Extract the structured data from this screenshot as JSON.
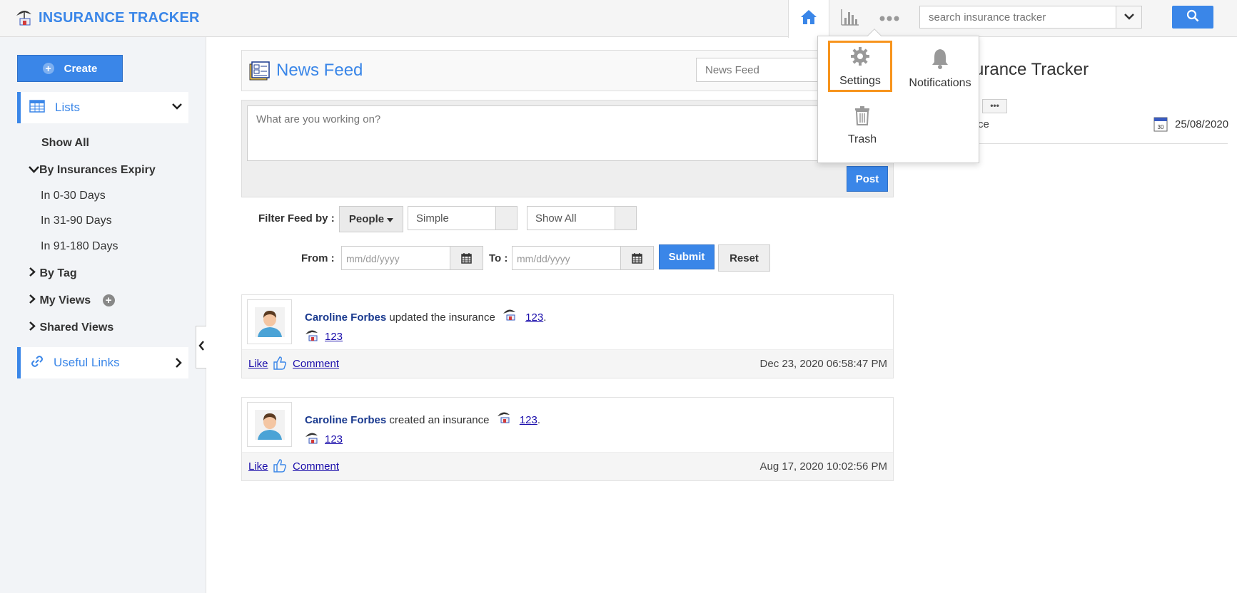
{
  "app": {
    "title": "INSURANCE TRACKER",
    "brand_color": "#3a86e8"
  },
  "header": {
    "search_placeholder": "search insurance tracker",
    "icons": [
      "home-icon",
      "chart-icon",
      "more-icon",
      "chevron-down-icon",
      "search-icon"
    ]
  },
  "sidebar": {
    "create_label": "Create",
    "lists_label": "Lists",
    "show_all": "Show All",
    "by_expiry": "By Insurances Expiry",
    "expiry_items": [
      "In 0-30 Days",
      "In 31-90 Days",
      "In 91-180 Days"
    ],
    "by_tag": "By Tag",
    "my_views": "My Views",
    "shared_views": "Shared Views",
    "useful_links": "Useful Links"
  },
  "feed": {
    "title": "News Feed",
    "select_value": "News Feed",
    "compose_placeholder": "What are you working on?",
    "post_label": "Post",
    "filter_label": "Filter Feed by :",
    "people_label": "People",
    "simple_value": "Simple",
    "show_all_value": "Show All",
    "from_label": "From :",
    "to_label": "To :",
    "date_placeholder": "mm/dd/yyyy",
    "submit_label": "Submit",
    "reset_label": "Reset",
    "posts": [
      {
        "user": "Caroline Forbes",
        "action": "updated the insurance",
        "item": "123",
        "punct": ".",
        "sub_link": "123",
        "like": "Like",
        "comment": "Comment",
        "timestamp": "Dec 23, 2020 06:58:47 PM"
      },
      {
        "user": "Caroline Forbes",
        "action": "created an insurance",
        "item": "123",
        "punct": ".",
        "sub_link": "123",
        "like": "Like",
        "comment": "Comment",
        "timestamp": "Aug 17, 2020 10:02:56 PM"
      }
    ]
  },
  "right_panel": {
    "title_fragment": "surance Tracker",
    "mini_button": "•••",
    "row_fragment": "ce",
    "date": "25/08/2020",
    "cal_day": "30"
  },
  "more_menu": {
    "items": [
      {
        "label": "Settings",
        "icon": "gear-icon",
        "selected": true
      },
      {
        "label": "Notifications",
        "icon": "bell-icon",
        "selected": false
      },
      {
        "label": "Trash",
        "icon": "trash-icon",
        "selected": false
      }
    ],
    "highlight_color": "#f7941d"
  }
}
